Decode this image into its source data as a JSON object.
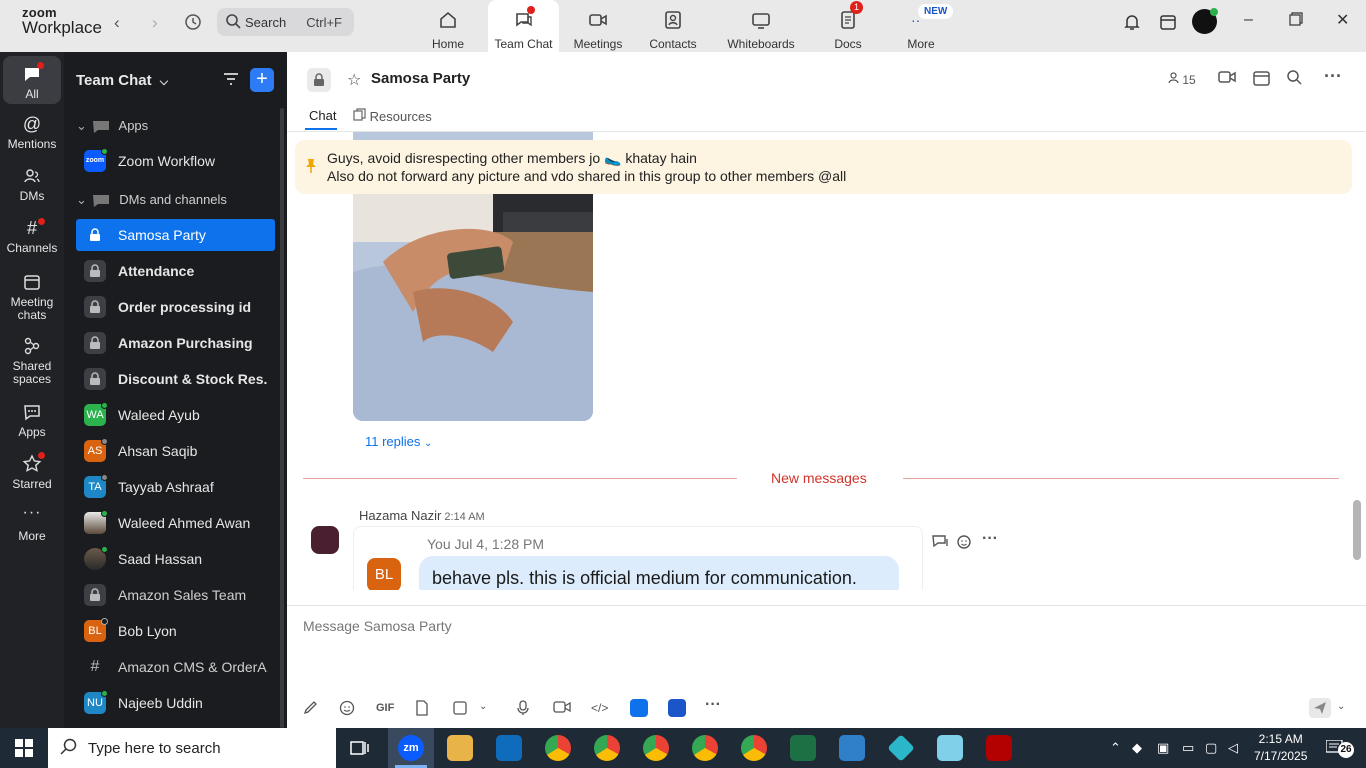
{
  "app": {
    "logo_line1": "zoom",
    "logo_line2": "Workplace",
    "search_label": "Search",
    "search_shortcut": "Ctrl+F"
  },
  "nav_tabs": [
    {
      "label": "Home",
      "icon": "home-icon"
    },
    {
      "label": "Team Chat",
      "icon": "chat-icon"
    },
    {
      "label": "Meetings",
      "icon": "video-icon"
    },
    {
      "label": "Contacts",
      "icon": "contacts-icon"
    },
    {
      "label": "Whiteboards",
      "icon": "whiteboard-icon"
    },
    {
      "label": "Docs",
      "icon": "docs-icon",
      "badge": "1"
    },
    {
      "label": "More",
      "icon": "more-icon",
      "badge": "NEW"
    }
  ],
  "rail": [
    {
      "label": "All",
      "icon": "chat-bubble-icon"
    },
    {
      "label": "Mentions",
      "icon": "at-icon"
    },
    {
      "label": "DMs",
      "icon": "people-icon"
    },
    {
      "label": "Channels",
      "icon": "hash-icon"
    },
    {
      "label": "Meeting chats",
      "icon": "calendar-icon"
    },
    {
      "label": "Shared spaces",
      "icon": "shared-icon"
    },
    {
      "label": "Apps",
      "icon": "apps-icon"
    },
    {
      "label": "Starred",
      "icon": "star-icon"
    },
    {
      "label": "More",
      "icon": "ellipsis-icon"
    }
  ],
  "sidebar": {
    "title": "Team Chat",
    "apps_section": "Apps",
    "app_item": "Zoom Workflow",
    "app_item_logo": "zoom",
    "dm_section": "DMs and channels",
    "items": [
      {
        "label": "Samosa Party",
        "type": "lock"
      },
      {
        "label": "Attendance",
        "type": "lock"
      },
      {
        "label": "Order processing id",
        "type": "lock"
      },
      {
        "label": "Amazon Purchasing",
        "type": "lock"
      },
      {
        "label": "Discount & Stock Res...",
        "type": "lock"
      },
      {
        "label": "Waleed Ayub",
        "type": "initials",
        "initials": "WA",
        "color": "#2bb24c"
      },
      {
        "label": "Ahsan Saqib",
        "type": "initials",
        "initials": "AS",
        "color": "#d9630f"
      },
      {
        "label": "Tayyab Ashraaf",
        "type": "initials",
        "initials": "TA",
        "color": "#1e88c7"
      },
      {
        "label": "Waleed Ahmed Awan",
        "type": "photo"
      },
      {
        "label": "Saad Hassan",
        "type": "photo"
      },
      {
        "label": "Amazon Sales Team",
        "type": "lock"
      },
      {
        "label": "Bob Lyon",
        "type": "initials",
        "initials": "BL",
        "color": "#d9630f"
      },
      {
        "label": "Amazon CMS & OrderA...",
        "type": "hash"
      },
      {
        "label": "Najeeb Uddin",
        "type": "initials",
        "initials": "NU",
        "color": "#1e88c7"
      }
    ]
  },
  "channel": {
    "title": "Samosa Party",
    "member_count": "15",
    "tab_chat": "Chat",
    "tab_resources": "Resources"
  },
  "pinned": {
    "line1": "Guys, avoid disrespecting other members jo 🥿 khatay hain",
    "line2": "Also do not forward any picture and vdo shared in this group to other members @all"
  },
  "thread": {
    "replies": "11 replies",
    "new_messages": "New messages",
    "sender": "Hazama Nazir",
    "time": "2:14 AM",
    "quoted_meta": "You Jul 4, 1:28 PM",
    "quoted_initials": "BL",
    "quoted_text": "behave pls. this is official medium for communication."
  },
  "composer": {
    "placeholder": "Message Samosa Party",
    "gif_label": "GIF"
  },
  "taskbar": {
    "search_placeholder": "Type here to search",
    "time": "2:15 AM",
    "date": "7/17/2025",
    "notification_count": "26"
  },
  "colors": {
    "accent": "#0e72ed",
    "sidebar_bg": "#1b1c1f",
    "pin_bg": "#fdf4e2",
    "new_messages": "#d0342c"
  }
}
